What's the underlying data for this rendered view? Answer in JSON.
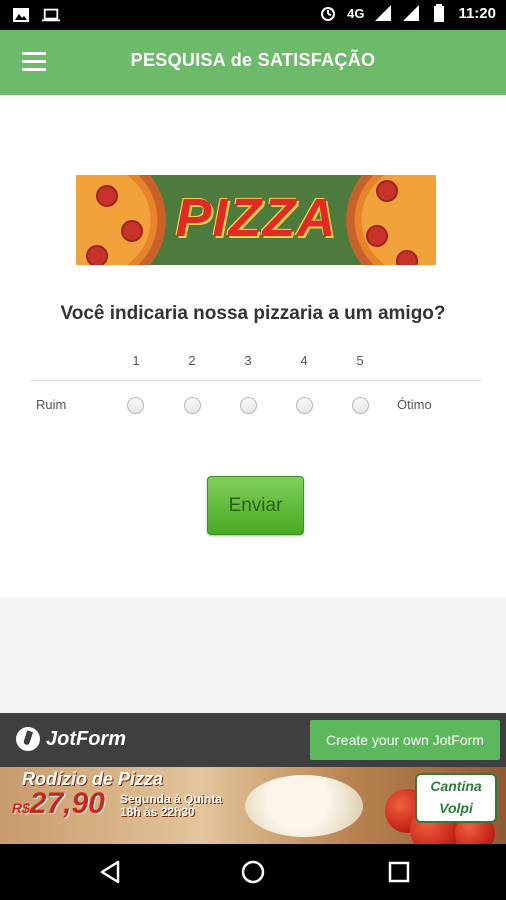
{
  "status_bar": {
    "time": "11:20",
    "network": "4G",
    "icons": [
      "image-icon",
      "laptop-icon",
      "alarm-icon",
      "signal-icon",
      "signal-icon",
      "battery-icon"
    ]
  },
  "app_bar": {
    "title": "PESQUISA de SATISFAÇÃO",
    "menu_icon": "hamburger-menu-icon"
  },
  "form": {
    "banner_text": "PIZZA",
    "question": "Você indicaria nossa pizzaria a um amigo?",
    "scale": {
      "options": [
        "1",
        "2",
        "3",
        "4",
        "5"
      ],
      "low_label": "Ruim",
      "high_label": "Ótimo",
      "selected": null
    },
    "submit_label": "Enviar"
  },
  "jotform_bar": {
    "logo_text": "JotForm",
    "create_label": "Create your own JotForm"
  },
  "ad": {
    "title": "Rodízio de Pizza",
    "currency": "R$",
    "price": "27,90",
    "line1": "Segunda à Quinta",
    "line2": "18h às 22h30",
    "brand_top": "Cantina",
    "brand_bottom": "Volpi"
  },
  "nav_bar": {
    "buttons": [
      "back-icon",
      "home-icon",
      "recents-icon"
    ]
  },
  "colors": {
    "app_bar": "#6dbb6a",
    "submit": "#5cb85c",
    "jotform_bar": "#3f3f41"
  }
}
